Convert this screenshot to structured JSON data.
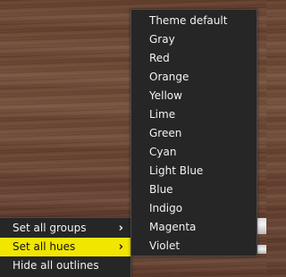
{
  "left_menu": {
    "items": [
      {
        "label": "Set all groups",
        "has_submenu": true,
        "highlighted": false
      },
      {
        "label": "Set all hues",
        "has_submenu": true,
        "highlighted": true
      },
      {
        "label": "Hide all outlines",
        "has_submenu": false,
        "highlighted": false
      }
    ],
    "submenu_indicator": "›",
    "submenu_icon": "chevron-right-icon"
  },
  "hue_menu": {
    "items": [
      {
        "label": "Theme default"
      },
      {
        "label": "Gray"
      },
      {
        "label": "Red"
      },
      {
        "label": "Orange"
      },
      {
        "label": "Yellow"
      },
      {
        "label": "Lime"
      },
      {
        "label": "Green"
      },
      {
        "label": "Cyan"
      },
      {
        "label": "Light Blue"
      },
      {
        "label": "Blue"
      },
      {
        "label": "Indigo"
      },
      {
        "label": "Magenta"
      },
      {
        "label": "Violet"
      }
    ]
  },
  "colors": {
    "menu_background": "#262626",
    "highlight": "#f1e600",
    "text": "#f2f2f2",
    "highlight_text": "#111111"
  }
}
